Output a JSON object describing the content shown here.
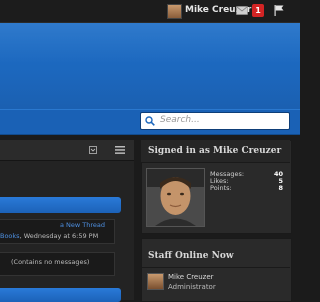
{
  "header": {
    "username": "Mike Creuzer",
    "alerts_count": "1"
  },
  "search": {
    "placeholder": "Search..."
  },
  "main": {
    "thread_link": "a New Thread",
    "thread_forum": "Books",
    "thread_time": ", Wednesday at 6:59 PM",
    "empty_message": "(Contains no messages)"
  },
  "sidebar": {
    "signed_in_title": "Signed in as Mike Creuzer",
    "stats": [
      {
        "label": "Messages:",
        "value": "40"
      },
      {
        "label": "Likes:",
        "value": "5"
      },
      {
        "label": "Points:",
        "value": "8"
      }
    ],
    "staff_title": "Staff Online Now",
    "staff_name": "Mike Creuzer",
    "staff_role": "Administrator"
  },
  "colors": {
    "banner_blue": "#1c67bd",
    "alert_red": "#d32424",
    "link_blue": "#4d8fe0",
    "background": "#1b1b1b"
  },
  "icons": [
    "user-avatar",
    "mail-icon",
    "flag-icon",
    "search-icon",
    "collapse-icon",
    "menu-icon"
  ]
}
